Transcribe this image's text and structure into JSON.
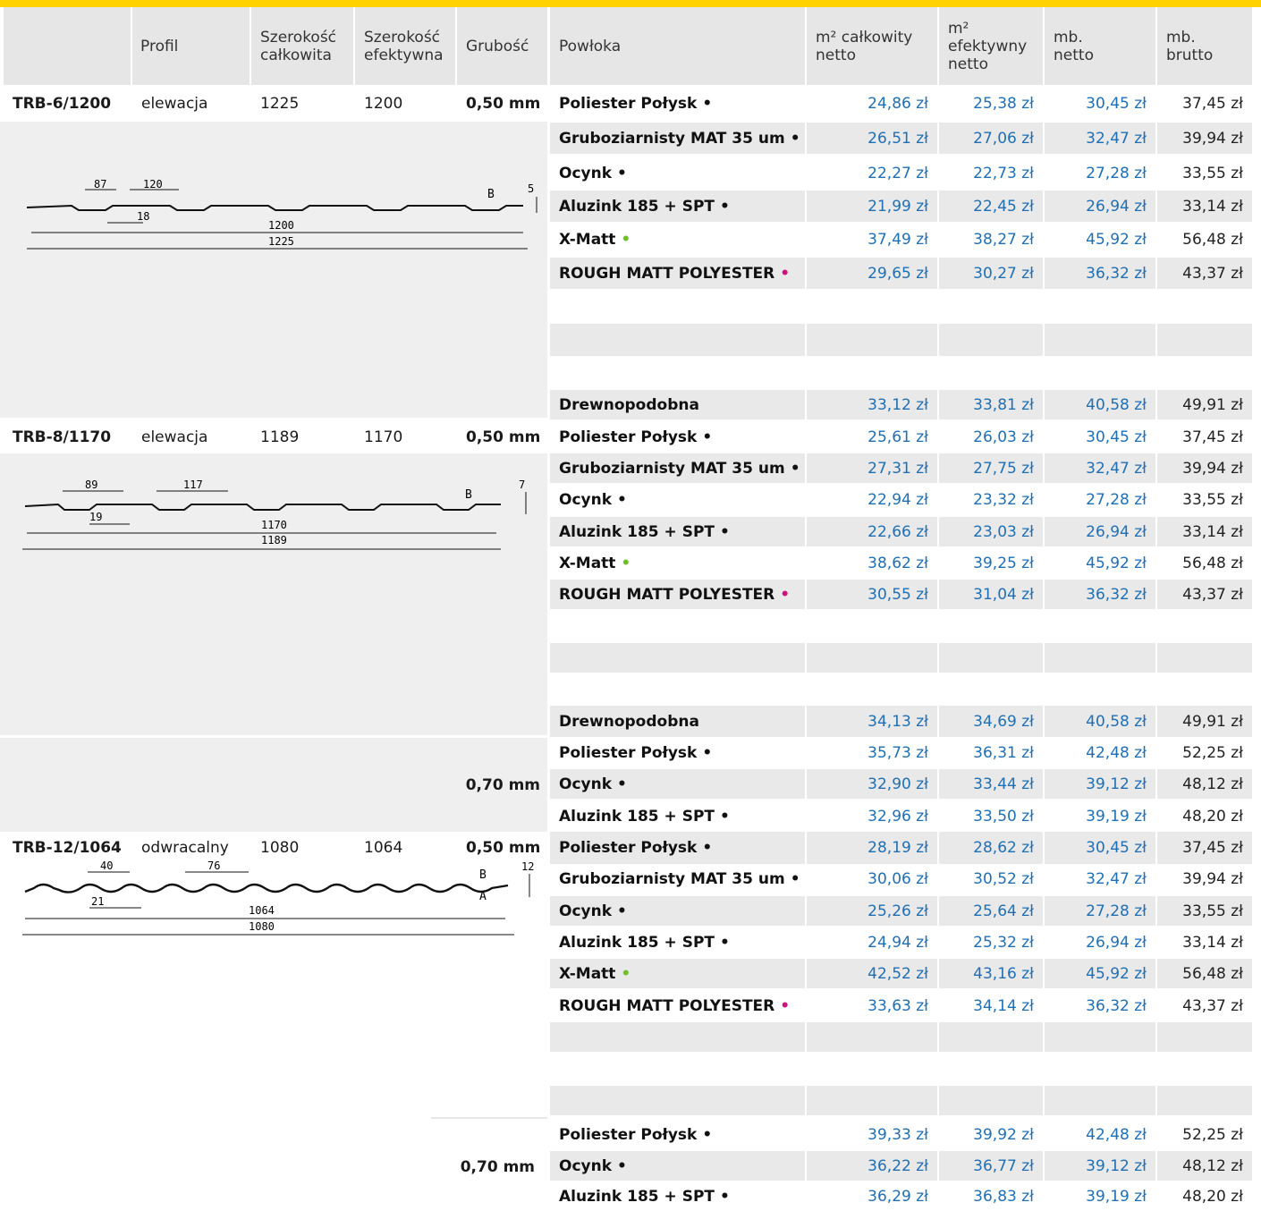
{
  "headers": {
    "profil": "Profil",
    "szer_calk_1": "Szerokość",
    "szer_calk_2": "całkowita",
    "szer_ef_1": "Szerokość",
    "szer_ef_2": "efektywna",
    "grubosc": "Grubość",
    "powloka": "Powłoka",
    "m2_calk_1": "m² całkowity",
    "m2_calk_2": "netto",
    "m2_ef_1": "m²",
    "m2_ef_2": "efektywny",
    "m2_ef_3": "netto",
    "mb_netto_1": "mb.",
    "mb_netto_2": "netto",
    "mb_brutto_1": "mb.",
    "mb_brutto_2": "brutto"
  },
  "products": [
    {
      "name": "TRB-6/1200",
      "profil": "elewacja",
      "szer_calk": "1225",
      "szer_ef": "1200",
      "grubosc": "0,50 mm"
    },
    {
      "name": "TRB-8/1170",
      "profil": "elewacja",
      "szer_calk": "1189",
      "szer_ef": "1170",
      "grubosc": "0,50 mm"
    },
    {
      "name": "TRB-12/1064",
      "profil": "odwracalny",
      "szer_calk": "1080",
      "szer_ef": "1064",
      "grubosc": "0,50 mm"
    }
  ],
  "thickness_070": "0,70 mm",
  "diagrams": {
    "d1": {
      "w1": "87",
      "w2": "120",
      "w3": "18",
      "h": "5",
      "side": "B",
      "eff": "1200",
      "total": "1225"
    },
    "d2": {
      "w1": "89",
      "w2": "117",
      "w3": "19",
      "h": "7",
      "side": "B",
      "eff": "1170",
      "total": "1189"
    },
    "d3": {
      "w1": "40",
      "w2": "76",
      "w3": "21",
      "h": "12",
      "side": "B",
      "side2": "A",
      "eff": "1064",
      "total": "1080"
    }
  },
  "rows": [
    {
      "coat": "Poliester Połysk",
      "dot": "•",
      "dc": "black",
      "p": [
        "24,86 zł",
        "25,38 zł",
        "30,45 zł",
        "37,45 zł"
      ]
    },
    {
      "coat": "Gruboziarnisty MAT 35 um",
      "dot": "•",
      "dc": "black",
      "p": [
        "26,51 zł",
        "27,06 zł",
        "32,47 zł",
        "39,94 zł"
      ]
    },
    {
      "coat": "Ocynk",
      "dot": "•",
      "dc": "black",
      "p": [
        "22,27 zł",
        "22,73 zł",
        "27,28 zł",
        "33,55 zł"
      ]
    },
    {
      "coat": "Aluzink 185 + SPT",
      "dot": "•",
      "dc": "black",
      "p": [
        "21,99 zł",
        "22,45 zł",
        "26,94 zł",
        "33,14 zł"
      ]
    },
    {
      "coat": "X-Matt",
      "dot": "•",
      "dc": "green",
      "p": [
        "37,49 zł",
        "38,27 zł",
        "45,92 zł",
        "56,48 zł"
      ]
    },
    {
      "coat": "ROUGH MATT POLYESTER",
      "dot": "•",
      "dc": "pink",
      "p": [
        "29,65 zł",
        "30,27 zł",
        "36,32 zł",
        "43,37 zł"
      ]
    },
    {
      "coat": "Drewnopodobna",
      "dot": "",
      "dc": "black",
      "p": [
        "33,12 zł",
        "33,81 zł",
        "40,58 zł",
        "49,91 zł"
      ]
    },
    {
      "coat": "Poliester Połysk",
      "dot": "•",
      "dc": "black",
      "p": [
        "25,61 zł",
        "26,03 zł",
        "30,45 zł",
        "37,45 zł"
      ]
    },
    {
      "coat": "Gruboziarnisty MAT 35 um",
      "dot": "•",
      "dc": "black",
      "p": [
        "27,31 zł",
        "27,75 zł",
        "32,47 zł",
        "39,94 zł"
      ]
    },
    {
      "coat": "Ocynk",
      "dot": "•",
      "dc": "black",
      "p": [
        "22,94 zł",
        "23,32 zł",
        "27,28 zł",
        "33,55 zł"
      ]
    },
    {
      "coat": "Aluzink 185 + SPT",
      "dot": "•",
      "dc": "black",
      "p": [
        "22,66 zł",
        "23,03 zł",
        "26,94 zł",
        "33,14 zł"
      ]
    },
    {
      "coat": "X-Matt",
      "dot": "•",
      "dc": "green",
      "p": [
        "38,62 zł",
        "39,25 zł",
        "45,92 zł",
        "56,48 zł"
      ]
    },
    {
      "coat": "ROUGH MATT POLYESTER",
      "dot": "•",
      "dc": "pink",
      "p": [
        "30,55 zł",
        "31,04 zł",
        "36,32 zł",
        "43,37 zł"
      ]
    },
    {
      "coat": "Drewnopodobna",
      "dot": "",
      "dc": "black",
      "p": [
        "34,13 zł",
        "34,69 zł",
        "40,58 zł",
        "49,91 zł"
      ]
    },
    {
      "coat": "Poliester Połysk",
      "dot": "•",
      "dc": "black",
      "p": [
        "35,73 zł",
        "36,31 zł",
        "42,48 zł",
        "52,25 zł"
      ]
    },
    {
      "coat": "Ocynk",
      "dot": "•",
      "dc": "black",
      "p": [
        "32,90 zł",
        "33,44 zł",
        "39,12 zł",
        "48,12 zł"
      ]
    },
    {
      "coat": "Aluzink 185 + SPT",
      "dot": "•",
      "dc": "black",
      "p": [
        "32,96 zł",
        "33,50 zł",
        "39,19 zł",
        "48,20 zł"
      ]
    },
    {
      "coat": "Poliester Połysk",
      "dot": "•",
      "dc": "black",
      "p": [
        "28,19 zł",
        "28,62 zł",
        "30,45 zł",
        "37,45 zł"
      ]
    },
    {
      "coat": "Gruboziarnisty MAT 35 um",
      "dot": "•",
      "dc": "black",
      "p": [
        "30,06 zł",
        "30,52 zł",
        "32,47 zł",
        "39,94 zł"
      ]
    },
    {
      "coat": "Ocynk",
      "dot": "•",
      "dc": "black",
      "p": [
        "25,26 zł",
        "25,64 zł",
        "27,28 zł",
        "33,55 zł"
      ]
    },
    {
      "coat": "Aluzink 185 + SPT",
      "dot": "•",
      "dc": "black",
      "p": [
        "24,94 zł",
        "25,32 zł",
        "26,94 zł",
        "33,14 zł"
      ]
    },
    {
      "coat": "X-Matt",
      "dot": "•",
      "dc": "green",
      "p": [
        "42,52 zł",
        "43,16 zł",
        "45,92 zł",
        "56,48 zł"
      ]
    },
    {
      "coat": "ROUGH MATT POLYESTER",
      "dot": "•",
      "dc": "pink",
      "p": [
        "33,63 zł",
        "34,14 zł",
        "36,32 zł",
        "43,37 zł"
      ]
    },
    {
      "coat": "Poliester Połysk",
      "dot": "•",
      "dc": "black",
      "p": [
        "39,33 zł",
        "39,92 zł",
        "42,48 zł",
        "52,25 zł"
      ]
    },
    {
      "coat": "Ocynk",
      "dot": "•",
      "dc": "black",
      "p": [
        "36,22 zł",
        "36,77 zł",
        "39,12 zł",
        "48,12 zł"
      ]
    },
    {
      "coat": "Aluzink 185 + SPT",
      "dot": "•",
      "dc": "black",
      "p": [
        "36,29 zł",
        "36,83 zł",
        "39,19 zł",
        "48,20 zł"
      ]
    }
  ]
}
